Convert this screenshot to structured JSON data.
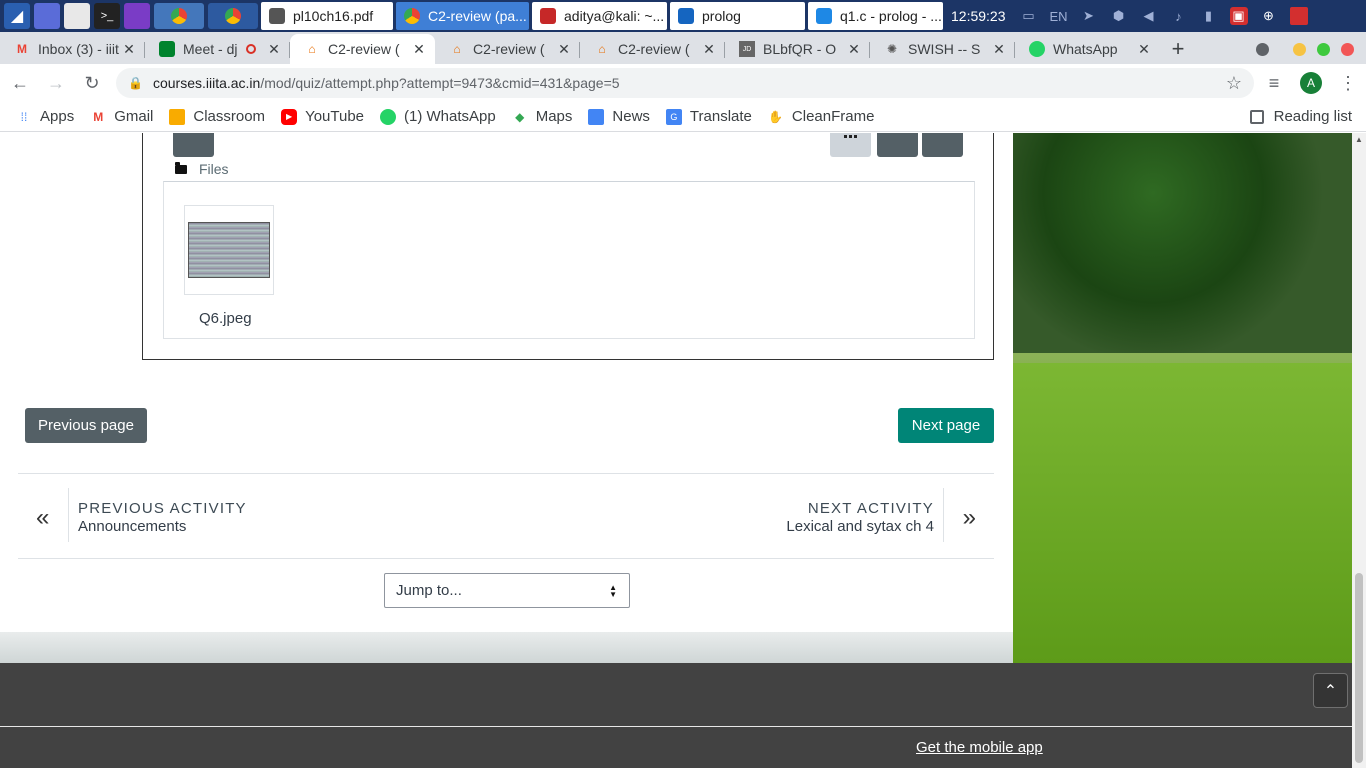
{
  "taskbar": {
    "windows": [
      {
        "label": "pl10ch16.pdf",
        "active": false,
        "color": "#555555"
      },
      {
        "label": "C2-review (pa...",
        "active": true,
        "color": "#ffffff"
      },
      {
        "label": "aditya@kali: ~...",
        "active": false,
        "color": "#c62828"
      },
      {
        "label": "prolog",
        "active": false,
        "color": "#1565c0"
      },
      {
        "label": "q1.c - prolog - ...",
        "active": false,
        "color": "#1e88e5"
      }
    ],
    "clock": "12:59:23",
    "language": "EN"
  },
  "tabs": [
    {
      "title": "Inbox (3) - iiit",
      "icon": "gmail-icon",
      "active": false
    },
    {
      "title": "Meet - dj",
      "icon": "meet-icon",
      "active": false
    },
    {
      "title": "C2-review (",
      "icon": "moodle-icon",
      "active": true
    },
    {
      "title": "C2-review (",
      "icon": "moodle-icon",
      "active": false
    },
    {
      "title": "C2-review (",
      "icon": "moodle-icon",
      "active": false
    },
    {
      "title": "BLbfQR - O",
      "icon": "jdoodle-icon",
      "active": false
    },
    {
      "title": "SWISH -- S",
      "icon": "swish-icon",
      "active": false
    },
    {
      "title": "WhatsApp",
      "icon": "whatsapp-icon",
      "active": false
    }
  ],
  "address": {
    "host": "courses.iiita.ac.in",
    "path": "/mod/quiz/attempt.php?attempt=9473&cmid=431&page=5",
    "profile_initial": "A"
  },
  "bookmarks": [
    {
      "label": "Apps",
      "icon": "apps-grid-icon"
    },
    {
      "label": "Gmail",
      "icon": "gmail-icon"
    },
    {
      "label": "Classroom",
      "icon": "classroom-icon"
    },
    {
      "label": "YouTube",
      "icon": "youtube-icon"
    },
    {
      "label": "(1) WhatsApp",
      "icon": "whatsapp-icon"
    },
    {
      "label": "Maps",
      "icon": "maps-icon"
    },
    {
      "label": "News",
      "icon": "news-icon"
    },
    {
      "label": "Translate",
      "icon": "translate-icon"
    },
    {
      "label": "CleanFrame",
      "icon": "cleanframe-icon"
    }
  ],
  "reading_list": "Reading list",
  "files": {
    "label": "Files",
    "items": [
      {
        "name": "Q6.jpeg"
      }
    ]
  },
  "buttons": {
    "previous": "Previous page",
    "next": "Next page"
  },
  "activity_nav": {
    "prev_key": "PREVIOUS ACTIVITY",
    "prev_value": "Announcements",
    "next_key": "NEXT ACTIVITY",
    "next_value": "Lexical and sytax ch 4"
  },
  "jump": {
    "selected": "Jump to..."
  },
  "footer": {
    "mobile_link": "Get the mobile app"
  },
  "colors": {
    "primary": "#008577",
    "secondary": "#546066",
    "footer": "#424242"
  }
}
